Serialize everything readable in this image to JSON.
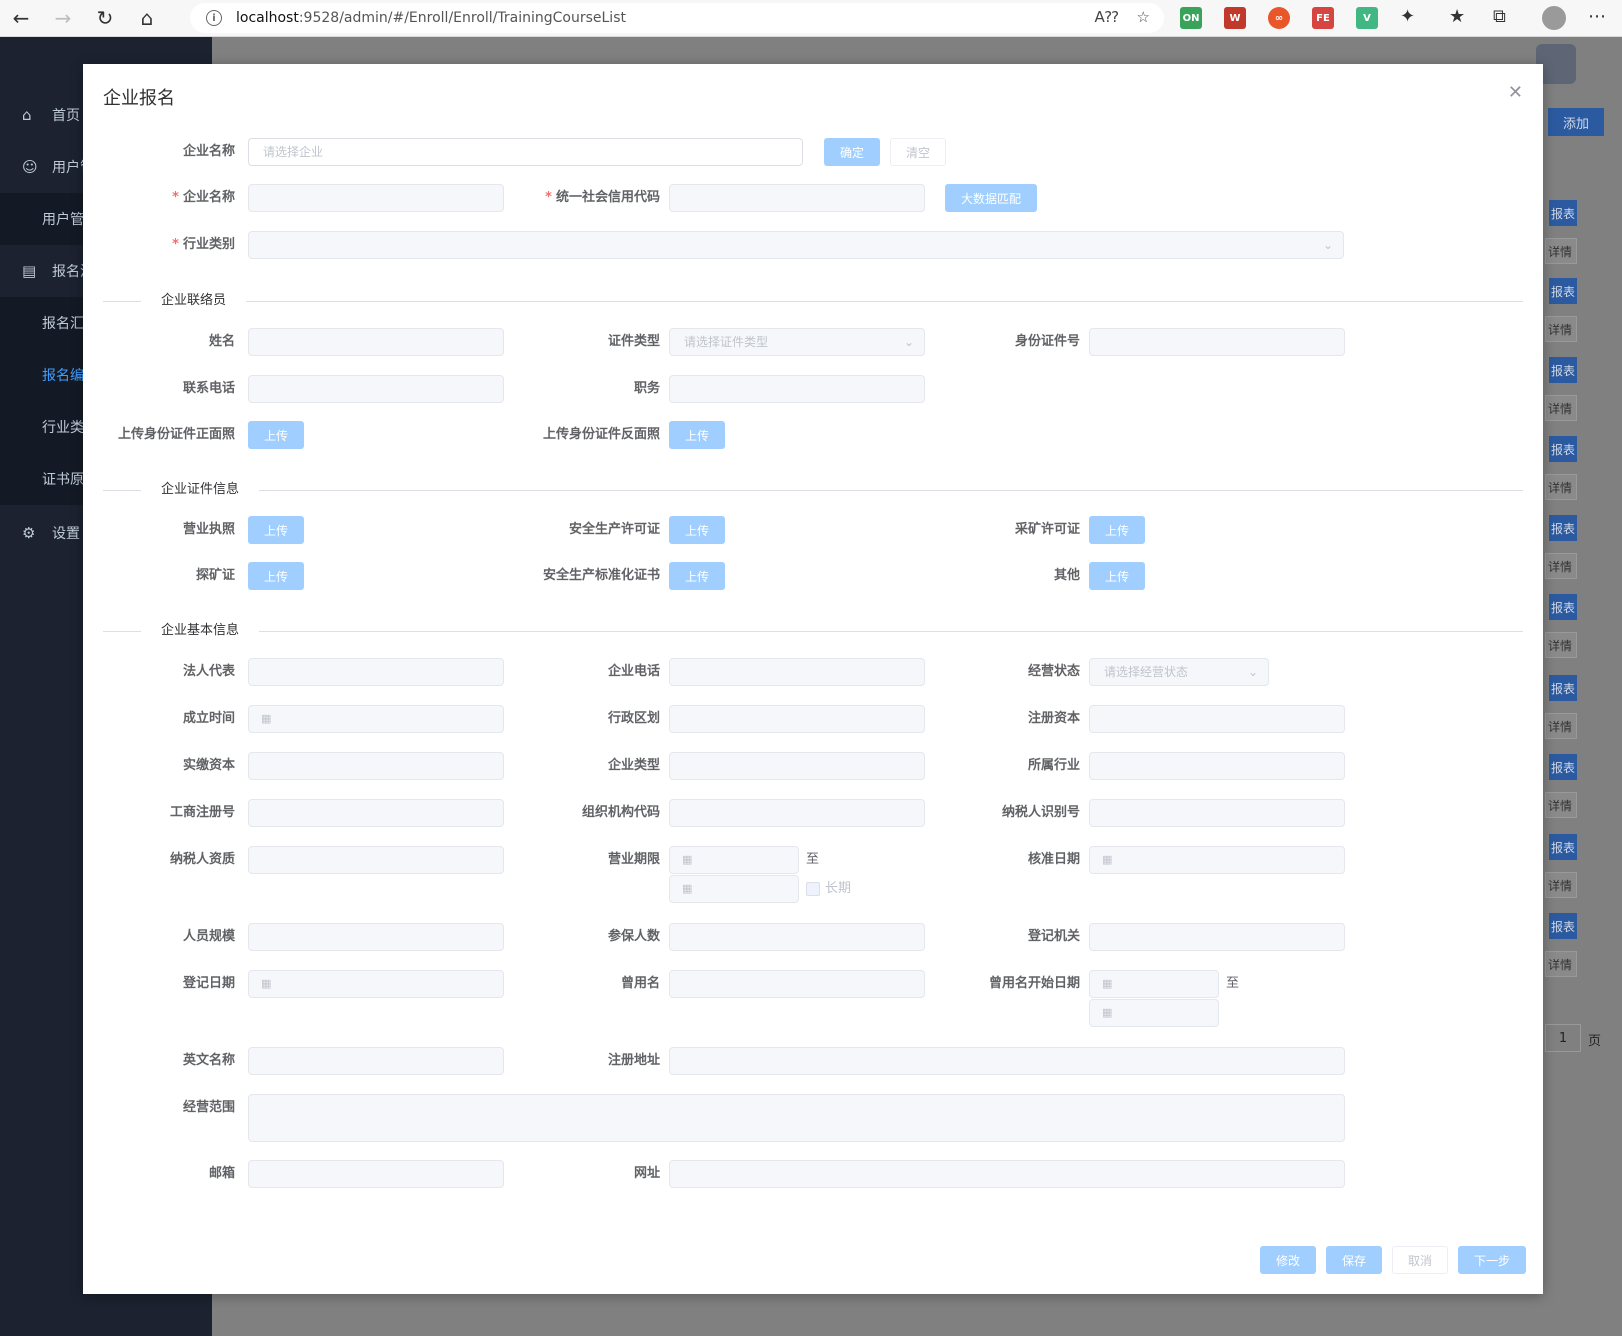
{
  "browser": {
    "url_host": "localhost",
    "url_path": ":9528/admin/#/Enroll/Enroll/TrainingCourseList"
  },
  "sidebar": {
    "items": [
      {
        "label": "首页",
        "icon": "home-icon"
      },
      {
        "label": "用户管",
        "icon": "user-icon"
      },
      {
        "label": "用户管",
        "icon": ""
      },
      {
        "label": "报名汇",
        "icon": "card-icon"
      },
      {
        "label": "报名汇",
        "icon": ""
      },
      {
        "label": "报名编",
        "icon": ""
      },
      {
        "label": "行业类",
        "icon": ""
      },
      {
        "label": "证书原",
        "icon": ""
      },
      {
        "label": "设置",
        "icon": "gear-icon"
      }
    ]
  },
  "background": {
    "add_label": "添加",
    "row_btn_a": "报表",
    "row_btn_b": "详情",
    "page_num": "1",
    "page_suffix": "页"
  },
  "dialog": {
    "title": "企业报名",
    "search": {
      "label": "企业名称",
      "placeholder": "请选择企业",
      "confirm": "确定",
      "clear": "清空"
    },
    "basic": {
      "name_label": "企业名称",
      "credit_label": "统一社会信用代码",
      "bigdata_btn": "大数据匹配",
      "industry_label": "行业类别"
    },
    "contact": {
      "section": "企业联络员",
      "name_label": "姓名",
      "idtype_label": "证件类型",
      "idtype_placeholder": "请选择证件类型",
      "idno_label": "身份证件号",
      "phone_label": "联系电话",
      "position_label": "职务",
      "front_label": "上传身份证件正面照",
      "back_label": "上传身份证件反面照",
      "upload": "上传"
    },
    "certs": {
      "section": "企业证件信息",
      "license": "营业执照",
      "safety_permit": "安全生产许可证",
      "mining_permit": "采矿许可证",
      "exploration": "探矿证",
      "safety_standard": "安全生产标准化证书",
      "other": "其他",
      "upload": "上传"
    },
    "info": {
      "section": "企业基本信息",
      "legal": "法人代表",
      "phone": "企业电话",
      "status": "经营状态",
      "status_placeholder": "请选择经营状态",
      "founded": "成立时间",
      "region": "行政区划",
      "reg_capital": "注册资本",
      "paid_capital": "实缴资本",
      "type": "企业类型",
      "industry": "所属行业",
      "biz_reg_no": "工商注册号",
      "org_code": "组织机构代码",
      "taxpayer_id": "纳税人识别号",
      "taxpayer_qual": "纳税人资质",
      "term": "营业期限",
      "to": "至",
      "long_term": "长期",
      "approve_date": "核准日期",
      "staff_size": "人员规模",
      "insured": "参保人数",
      "reg_authority": "登记机关",
      "reg_date": "登记日期",
      "former_name": "曾用名",
      "former_start": "曾用名开始日期",
      "english_name": "英文名称",
      "reg_address": "注册地址",
      "scope": "经营范围",
      "email": "邮箱",
      "website": "网址"
    },
    "footer": {
      "edit": "修改",
      "save": "保存",
      "cancel": "取消",
      "next": "下一步"
    }
  }
}
